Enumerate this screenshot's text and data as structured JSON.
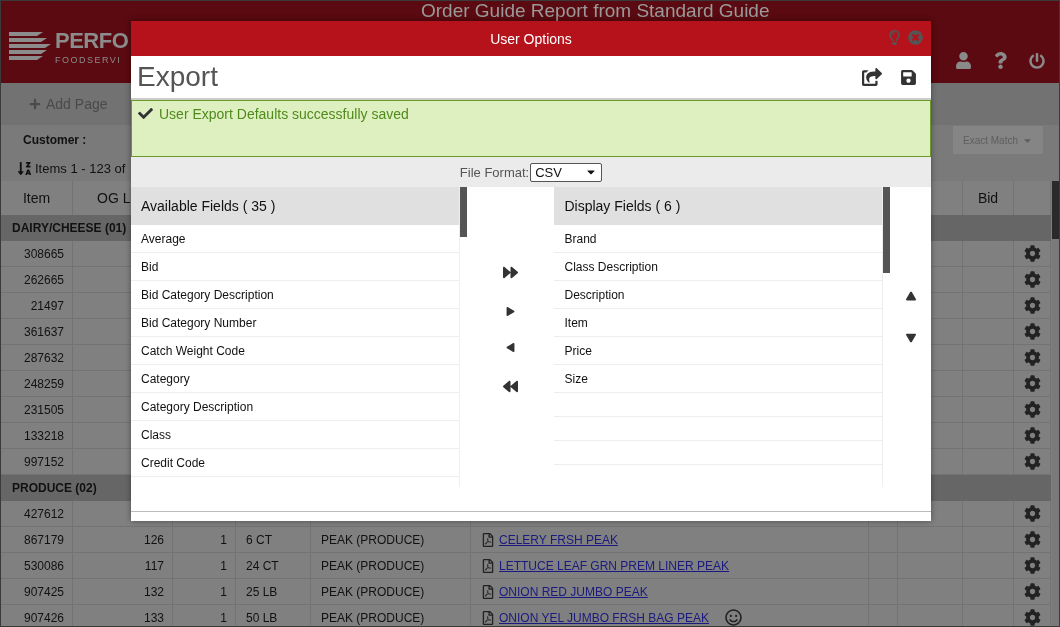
{
  "header": {
    "logo_line_1": "PERFO",
    "logo_line_2": "FOODSERVI",
    "title": "Order Guide Report from Standard Guide"
  },
  "toolbar": {
    "add_page": "Add Page"
  },
  "filter": {
    "customer_label": "Customer :",
    "match": "Exact Match"
  },
  "summary": "Items 1 - 123 of",
  "table": {
    "columns": [
      {
        "label": "Item"
      },
      {
        "label": "OG L"
      },
      {},
      {},
      {},
      {},
      {},
      {},
      {
        "label": "Bid"
      },
      {}
    ],
    "groups": [
      {
        "title": "DAIRY/CHEESE (01)",
        "rows": [
          {
            "item": "308665"
          },
          {
            "item": "262665"
          },
          {
            "item": "21497"
          },
          {
            "item": "361637"
          },
          {
            "item": "287632"
          },
          {
            "item": "248259"
          },
          {
            "item": "231505"
          },
          {
            "item": "133218"
          },
          {
            "item": "997152"
          }
        ]
      },
      {
        "title": "PRODUCE (02)",
        "rows": [
          {
            "item": "427612"
          },
          {
            "item": "867179",
            "og_line": "126",
            "qty": "1",
            "size": "6 CT",
            "brand": "PEAK (PRODUCE)",
            "description": "CELERY FRSH PEAK",
            "comment": false
          },
          {
            "item": "530086",
            "og_line": "117",
            "qty": "1",
            "size": "24 CT",
            "brand": "PEAK (PRODUCE)",
            "description": "LETTUCE LEAF GRN PREM LINER PEAK",
            "comment": false
          },
          {
            "item": "907425",
            "og_line": "132",
            "qty": "1",
            "size": "25 LB",
            "brand": "PEAK (PRODUCE)",
            "description": "ONION RED JUMBO PEAK",
            "comment": false
          },
          {
            "item": "907426",
            "og_line": "133",
            "qty": "1",
            "size": "50 LB",
            "brand": "PEAK (PRODUCE)",
            "description": "ONION YEL JUMBO FRSH BAG PEAK",
            "comment": true
          }
        ]
      }
    ]
  },
  "dialog": {
    "title": "User Options",
    "heading": "Export",
    "message": "User Export Defaults successfully saved",
    "file_format_label": "File Format:",
    "file_format": "CSV",
    "available": {
      "title": "Available Fields ( 35 )",
      "items": [
        "Average",
        "Bid",
        "Bid Category Description",
        "Bid Category Number",
        "Catch Weight Code",
        "Category",
        "Category Description",
        "Class",
        "Credit Code"
      ]
    },
    "display": {
      "title": "Display Fields ( 6 )",
      "items": [
        "Brand",
        "Class Description",
        "Description",
        "Item",
        "Price",
        "Size"
      ]
    }
  }
}
